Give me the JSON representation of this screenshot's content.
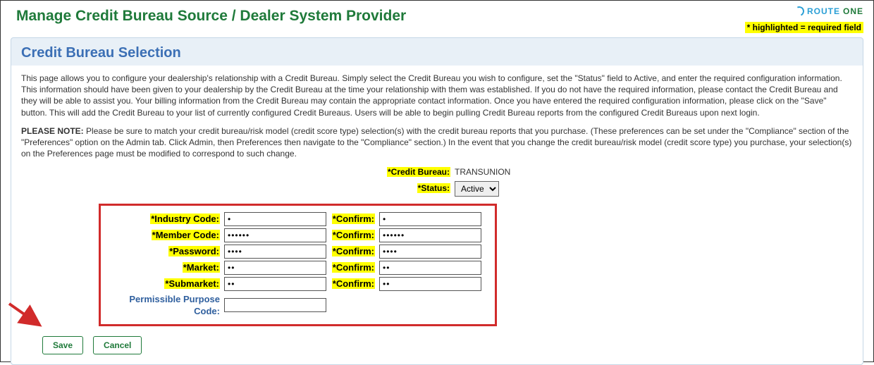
{
  "header": {
    "title": "Manage Credit Bureau Source / Dealer System Provider",
    "brand_route": "ROUTE",
    "brand_one": "ONE",
    "required_note": "* highlighted = required field"
  },
  "panel": {
    "title": "Credit Bureau Selection",
    "intro": "This page allows you to configure your dealership's relationship with a Credit Bureau. Simply select the Credit Bureau you wish to configure, set the \"Status\" field to Active, and enter the required configuration information. This information should have been given to your dealership by the Credit Bureau at the time your relationship with them was established. If you do not have the required information, please contact the Credit Bureau and they will be able to assist you. Your billing information from the Credit Bureau may contain the appropriate contact information. Once you have entered the required configuration information, please click on the \"Save\" button. This will add the Credit Bureau to your list of currently configured Credit Bureaus. Users will be able to begin pulling Credit Bureau reports from the configured Credit Bureaus upon next login.",
    "note_label": "PLEASE NOTE:",
    "note_text": " Please be sure to match your credit bureau/risk model (credit score type) selection(s) with the credit bureau reports that you purchase. (These preferences can be set under the \"Compliance\" section of the \"Preferences\" option on the Admin tab. Click Admin, then Preferences then navigate to the \"Compliance\" section.) In the event that you change the credit bureau/risk model (credit score type) you purchase, your selection(s) on the Preferences page must be modified to correspond to such change."
  },
  "top": {
    "credit_bureau_label": "*Credit Bureau:",
    "credit_bureau_value": "TRANSUNION",
    "status_label": "*Status:",
    "status_options": [
      "Active"
    ],
    "status_value": "Active"
  },
  "fields": {
    "industry_code": {
      "label": "*Industry Code:",
      "value": "•",
      "confirm_label": "*Confirm:",
      "confirm_value": "•"
    },
    "member_code": {
      "label": "*Member Code:",
      "value": "••••••",
      "confirm_label": "*Confirm:",
      "confirm_value": "••••••"
    },
    "password": {
      "label": "*Password:",
      "value": "••••",
      "confirm_label": "*Confirm:",
      "confirm_value": "••••"
    },
    "market": {
      "label": "*Market:",
      "value": "••",
      "confirm_label": "*Confirm:",
      "confirm_value": "••"
    },
    "submarket": {
      "label": "*Submarket:",
      "value": "••",
      "confirm_label": "*Confirm:",
      "confirm_value": "••"
    },
    "ppc": {
      "label": "Permissible Purpose Code:",
      "value": ""
    }
  },
  "buttons": {
    "save": "Save",
    "cancel": "Cancel"
  }
}
